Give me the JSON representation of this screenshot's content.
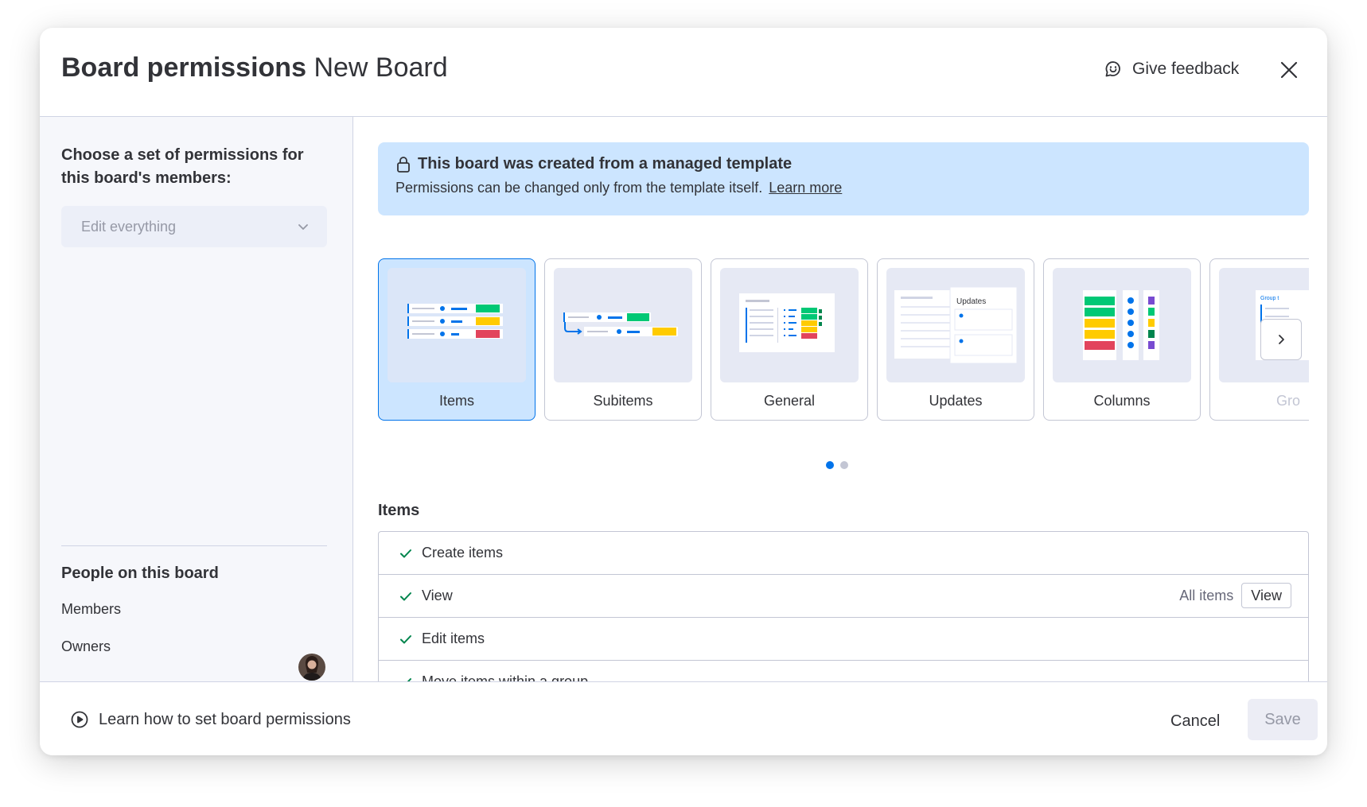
{
  "header": {
    "title_bold": "Board permissions",
    "title_board": "New Board",
    "feedback_label": "Give feedback"
  },
  "sidebar": {
    "heading": "Choose a set of permissions for this board's members:",
    "dropdown_value": "Edit everything",
    "people_title": "People on this board",
    "members_label": "Members",
    "owners_label": "Owners"
  },
  "banner": {
    "title": "This board was created from a managed template",
    "text": "Permissions can be changed only from the template itself.",
    "link": "Learn more"
  },
  "cards": [
    {
      "label": "Items",
      "selected": true
    },
    {
      "label": "Subitems",
      "selected": false
    },
    {
      "label": "General",
      "selected": false
    },
    {
      "label": "Updates",
      "selected": false,
      "thumb_title": "Updates"
    },
    {
      "label": "Columns",
      "selected": false
    },
    {
      "label": "Gro",
      "selected": false,
      "thumb_title": "Group t"
    }
  ],
  "carousel": {
    "page": 1,
    "pages": 2
  },
  "section": {
    "title": "Items"
  },
  "permissions": [
    {
      "label": "Create items"
    },
    {
      "label": "View",
      "scope": "All items",
      "button": "View"
    },
    {
      "label": "Edit items"
    },
    {
      "label": "Move items within a group"
    }
  ],
  "footer": {
    "learn_label": "Learn how to set board permissions",
    "cancel_label": "Cancel",
    "save_label": "Save"
  },
  "colors": {
    "accent": "#0073ea",
    "banner_bg": "#cce5ff",
    "check": "#00854d",
    "green": "#00c875",
    "yellow": "#ffcb00",
    "red": "#e2445c"
  }
}
